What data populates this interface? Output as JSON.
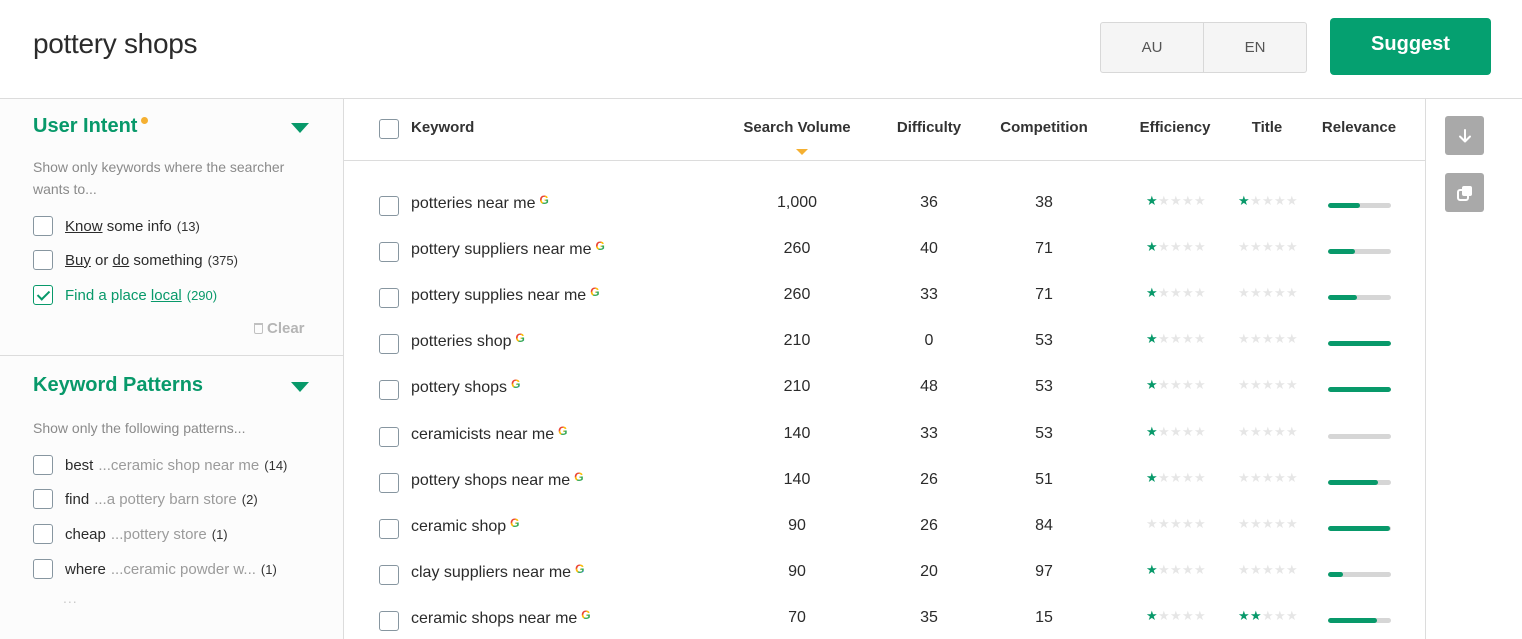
{
  "header": {
    "query": "pottery shops",
    "locale": {
      "country": "AU",
      "language": "EN"
    },
    "suggest_label": "Suggest",
    "accent_color": "#05a070"
  },
  "sidebar": {
    "user_intent": {
      "title": "User Intent",
      "description": "Show only keywords where the searcher wants to...",
      "options": [
        {
          "parts": [
            {
              "t": "Know",
              "u": true
            },
            {
              "t": " some info"
            }
          ],
          "count": "(13)",
          "checked": false
        },
        {
          "parts": [
            {
              "t": "Buy",
              "u": true
            },
            {
              "t": " or "
            },
            {
              "t": "do",
              "u": true
            },
            {
              "t": " something"
            }
          ],
          "count": "(375)",
          "checked": false
        },
        {
          "parts": [
            {
              "t": "Find a place "
            },
            {
              "t": "local",
              "u": true
            }
          ],
          "count": "(290)",
          "checked": true
        }
      ],
      "clear_label": "Clear"
    },
    "keyword_patterns": {
      "title": "Keyword Patterns",
      "description": "Show only the following patterns...",
      "options": [
        {
          "word": "best",
          "example": "...ceramic shop near me",
          "count": "(14)",
          "checked": false
        },
        {
          "word": "find",
          "example": "...a pottery barn store",
          "count": "(2)",
          "checked": false
        },
        {
          "word": "cheap",
          "example": "...pottery store",
          "count": "(1)",
          "checked": false
        },
        {
          "word": "where",
          "example": "...ceramic powder w...",
          "count": "(1)",
          "checked": false
        }
      ],
      "more": "..."
    }
  },
  "table": {
    "columns": {
      "keyword": "Keyword",
      "search_volume": "Search Volume",
      "difficulty": "Difficulty",
      "competition": "Competition",
      "efficiency": "Efficiency",
      "title": "Title",
      "relevance": "Relevance"
    },
    "sorted_by": "search_volume",
    "rows": [
      {
        "keyword": "potteries near me",
        "volume": "1,000",
        "difficulty": "36",
        "competition": "38",
        "efficiency": 1,
        "title": 1,
        "relevance": 0.5
      },
      {
        "keyword": "pottery suppliers near me",
        "volume": "260",
        "difficulty": "40",
        "competition": "71",
        "efficiency": 1,
        "title": 0,
        "relevance": 0.43
      },
      {
        "keyword": "pottery supplies near me",
        "volume": "260",
        "difficulty": "33",
        "competition": "71",
        "efficiency": 1,
        "title": 0,
        "relevance": 0.46
      },
      {
        "keyword": "potteries shop",
        "volume": "210",
        "difficulty": "0",
        "competition": "53",
        "efficiency": 1,
        "title": 0,
        "relevance": 1.0
      },
      {
        "keyword": "pottery shops",
        "volume": "210",
        "difficulty": "48",
        "competition": "53",
        "efficiency": 1,
        "title": 0,
        "relevance": 1.0
      },
      {
        "keyword": "ceramicists near me",
        "volume": "140",
        "difficulty": "33",
        "competition": "53",
        "efficiency": 1,
        "title": 0,
        "relevance": 0.0
      },
      {
        "keyword": "pottery shops near me",
        "volume": "140",
        "difficulty": "26",
        "competition": "51",
        "efficiency": 1,
        "title": 0,
        "relevance": 0.8
      },
      {
        "keyword": "ceramic shop",
        "volume": "90",
        "difficulty": "26",
        "competition": "84",
        "efficiency": 0,
        "title": 0,
        "relevance": 0.98
      },
      {
        "keyword": "clay suppliers near me",
        "volume": "90",
        "difficulty": "20",
        "competition": "97",
        "efficiency": 1,
        "title": 0,
        "relevance": 0.24
      },
      {
        "keyword": "ceramic shops near me",
        "volume": "70",
        "difficulty": "35",
        "competition": "15",
        "efficiency": 1,
        "title": 2,
        "relevance": 0.78
      }
    ],
    "max_stars": 5
  },
  "rail": {
    "download_icon": "arrow-down-icon",
    "copy_icon": "copy-icon"
  }
}
